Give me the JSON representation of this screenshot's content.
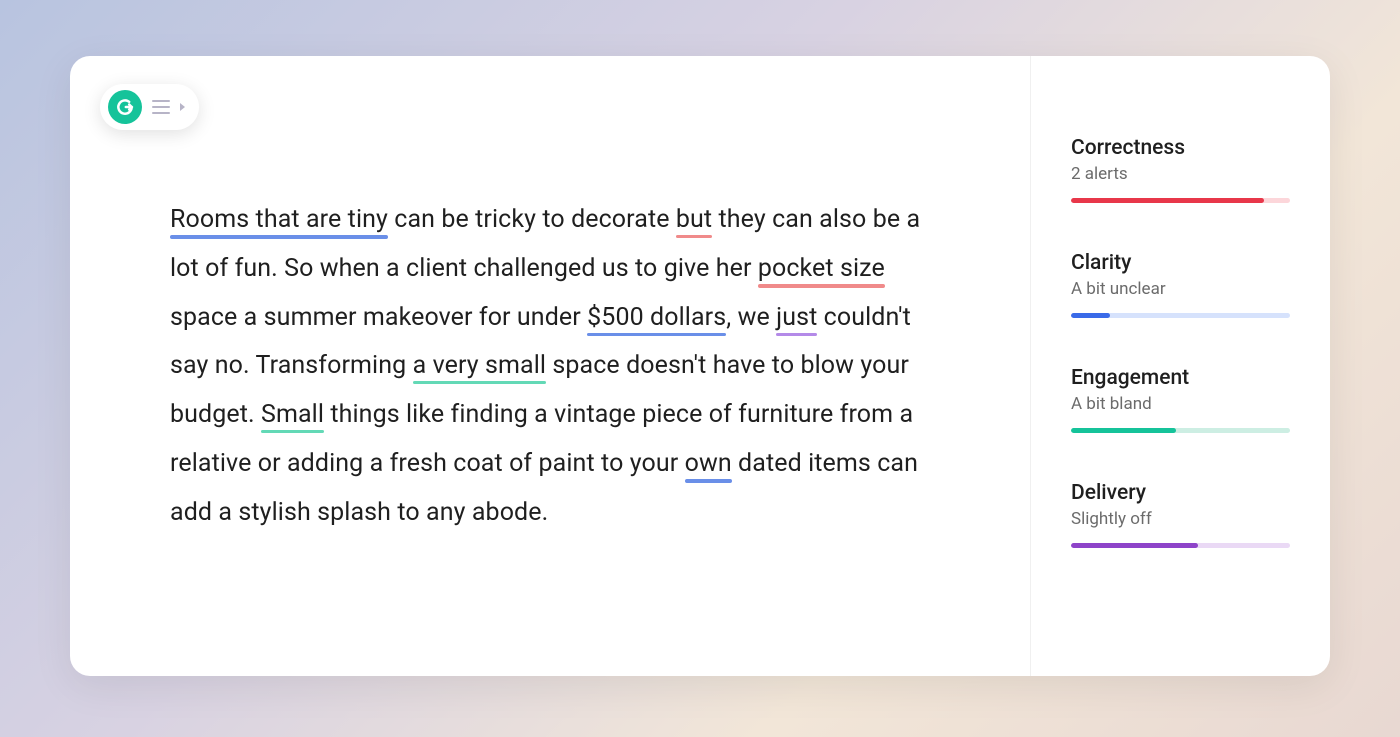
{
  "text": {
    "seg0": "Rooms that are tiny",
    "seg1": " can be tricky to decorate ",
    "seg2": "but",
    "seg3": " they can also be a lot of fun.  So when a client challenged us to give her ",
    "seg4": "pocket size",
    "seg5": " space a summer makeover for under ",
    "seg6": "$500 dollars",
    "seg7": ", we ",
    "seg8": "just",
    "seg9": " couldn't say no. Transforming ",
    "seg10": "a very small",
    "seg11": " space doesn't have to blow your budget. ",
    "seg12": "Small",
    "seg13": " things like finding a vintage piece of furniture from a relative or adding a fresh coat of paint to your ",
    "seg14": "own",
    "seg15": " dated items can add a stylish splash to any abode."
  },
  "underline_colors": {
    "seg0": "blue-thick",
    "seg2": "pink-thin",
    "seg4": "pink",
    "seg6": "blue",
    "seg8": "purple",
    "seg10": "green",
    "seg12": "green",
    "seg14": "blue-thick"
  },
  "sidebar": {
    "metrics": [
      {
        "title": "Correctness",
        "sub": "2 alerts",
        "color": "red",
        "pct": 88
      },
      {
        "title": "Clarity",
        "sub": "A bit unclear",
        "color": "blue",
        "pct": 18
      },
      {
        "title": "Engagement",
        "sub": "A bit bland",
        "color": "green",
        "pct": 48
      },
      {
        "title": "Delivery",
        "sub": "Slightly off",
        "color": "purple",
        "pct": 58
      }
    ]
  },
  "colors": {
    "brand_green": "#15c39a",
    "underline_blue": "#6a8fe8",
    "underline_pink": "#f08a8a",
    "underline_purple": "#b48ae8",
    "underline_green": "#63d9b6",
    "bar_red": "#e8374a",
    "bar_blue": "#3a6ae8",
    "bar_green": "#15c39a",
    "bar_purple": "#8e44c9"
  }
}
